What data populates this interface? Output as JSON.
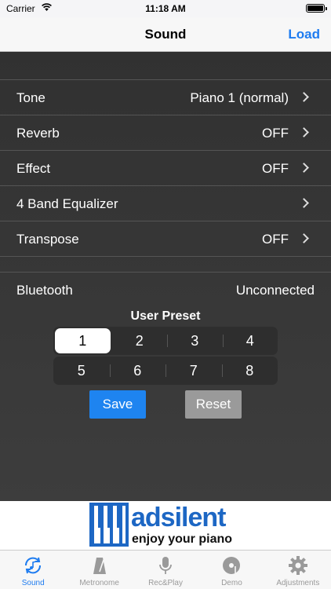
{
  "status_bar": {
    "carrier": "Carrier",
    "time": "11:18 AM"
  },
  "nav": {
    "title": "Sound",
    "load": "Load"
  },
  "settings": [
    {
      "label": "Tone",
      "value": "Piano 1 (normal)"
    },
    {
      "label": "Reverb",
      "value": "OFF"
    },
    {
      "label": "Effect",
      "value": "OFF"
    },
    {
      "label": "4 Band Equalizer",
      "value": ""
    },
    {
      "label": "Transpose",
      "value": "OFF"
    }
  ],
  "bluetooth": {
    "label": "Bluetooth",
    "value": "Unconnected"
  },
  "user_preset": {
    "title": "User Preset",
    "buttons": [
      "1",
      "2",
      "3",
      "4",
      "5",
      "6",
      "7",
      "8"
    ],
    "selected": "1",
    "save": "Save",
    "reset": "Reset"
  },
  "ad": {
    "brand": "adsilent",
    "tagline": "enjoy your piano"
  },
  "tabs": [
    {
      "label": "Sound",
      "icon": "sound-icon",
      "active": true
    },
    {
      "label": "Metronome",
      "icon": "metronome-icon",
      "active": false
    },
    {
      "label": "Rec&Play",
      "icon": "microphone-icon",
      "active": false
    },
    {
      "label": "Demo",
      "icon": "demo-disc-icon",
      "active": false
    },
    {
      "label": "Adjustments",
      "icon": "gear-icon",
      "active": false
    }
  ],
  "colors": {
    "accent": "#1e7cf0",
    "save_button": "#1e84f0",
    "reset_button": "#9a9a9a",
    "brand": "#1d67c4"
  }
}
